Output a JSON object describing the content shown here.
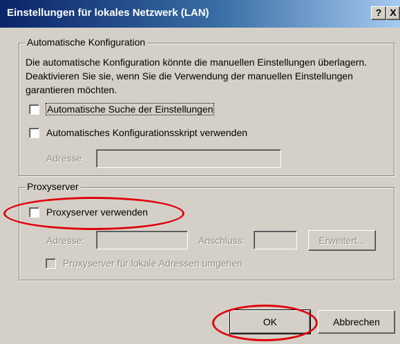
{
  "window": {
    "title": "Einstellungen für lokales Netzwerk (LAN)",
    "help_label": "?",
    "close_label": "X"
  },
  "auto_config": {
    "legend": "Automatische Konfiguration",
    "description": "Die automatische Konfiguration könnte die manuellen Einstellungen überlagern. Deaktivieren Sie sie, wenn Sie die Verwendung der manuellen Einstellungen garantieren möchten.",
    "auto_detect_label": "Automatische Suche der Einstellungen",
    "auto_detect_checked": false,
    "script_label": "Automatisches Konfigurationsskript verwenden",
    "script_checked": false,
    "address_label": "Adresse",
    "address_value": ""
  },
  "proxy": {
    "legend": "Proxyserver",
    "use_proxy_label": "Proxyserver verwenden",
    "use_proxy_checked": false,
    "address_label": "Adresse:",
    "address_value": "",
    "port_label": "Anschluss:",
    "port_value": "",
    "advanced_label": "Erweitert...",
    "bypass_label": "Proxyserver für lokale Adressen umgehen",
    "bypass_checked": false
  },
  "buttons": {
    "ok_label": "OK",
    "cancel_label": "Abbrechen"
  },
  "colors": {
    "annotation": "#e0000a",
    "titlebar_start": "#0a246a",
    "titlebar_end": "#a6caf0",
    "dialog_bg": "#d4d0c8"
  }
}
